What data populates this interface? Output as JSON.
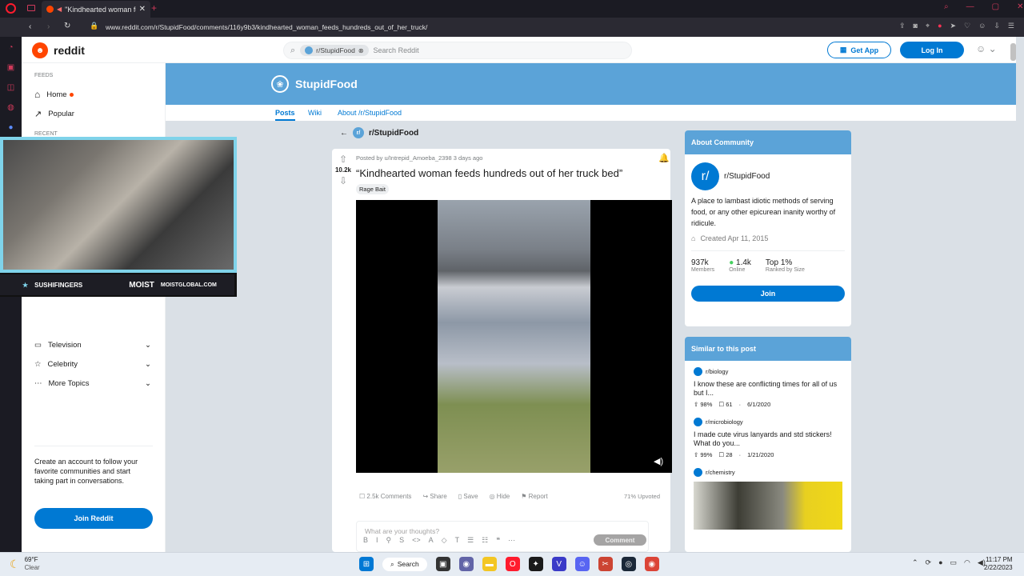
{
  "browser": {
    "tab_title": "\"Kindhearted woman fe",
    "url": "www.reddit.com/r/StupidFood/comments/116y9b3/kindhearted_woman_feeds_hundreds_out_of_her_truck/",
    "new_tab": "+"
  },
  "header": {
    "brand": "reddit",
    "search_chip": "r/StupidFood",
    "search_placeholder": "Search Reddit",
    "get_app": "Get App",
    "login": "Log In"
  },
  "left_nav": {
    "feeds_label": "FEEDS",
    "home": "Home",
    "popular": "Popular",
    "recent_label": "RECENT",
    "topics": [
      "Television",
      "Celebrity",
      "More Topics"
    ],
    "promo": "Create an account to follow your favorite communities and start taking part in conversations.",
    "join": "Join Reddit"
  },
  "subreddit": {
    "name": "StupidFood",
    "tabs": [
      "Posts",
      "Wiki",
      "About /r/StupidFood"
    ],
    "back_label": "r/StupidFood"
  },
  "post": {
    "meta": "Posted by u/Intrepid_Amoeba_2398 3 days ago",
    "votes": "10.2k",
    "title": "“Kindhearted woman feeds hundreds out of her truck bed”",
    "flair": "Rage Bait",
    "actions": {
      "comments": "2.5k Comments",
      "share": "Share",
      "save": "Save",
      "hide": "Hide",
      "report": "Report"
    },
    "upvoted": "71% Upvoted",
    "comment_placeholder": "What are your thoughts?",
    "comment_btn": "Comment"
  },
  "about": {
    "header": "About Community",
    "name": "r/StupidFood",
    "desc": "A place to lambast idiotic methods of serving food, or any other epicurean inanity worthy of ridicule.",
    "created": "Created Apr 11, 2015",
    "stats": [
      {
        "value": "937k",
        "label": "Members"
      },
      {
        "value": "1.4k",
        "label": "Online"
      },
      {
        "value": "Top 1%",
        "label": "Ranked by Size"
      }
    ],
    "join": "Join"
  },
  "similar": {
    "header": "Similar to this post",
    "items": [
      {
        "sub": "r/biology",
        "title": "I know these are conflicting times for all of us but I...",
        "pct": "98%",
        "comments": "61",
        "date": "6/1/2020"
      },
      {
        "sub": "r/microbiology",
        "title": "I made cute virus lanyards and std stickers! What do you...",
        "pct": "99%",
        "comments": "28",
        "date": "1/21/2020"
      },
      {
        "sub": "r/chemistry",
        "title": "",
        "pct": "",
        "comments": "",
        "date": ""
      }
    ]
  },
  "webcam": {
    "name": "SUSHIFINGERS",
    "brand": "MOIST",
    "site": "MOISTGLOBAL.COM"
  },
  "taskbar": {
    "temp": "69°F",
    "weather": "Clear",
    "search": "Search",
    "time": "11:17 PM",
    "date": "2/22/2023"
  }
}
